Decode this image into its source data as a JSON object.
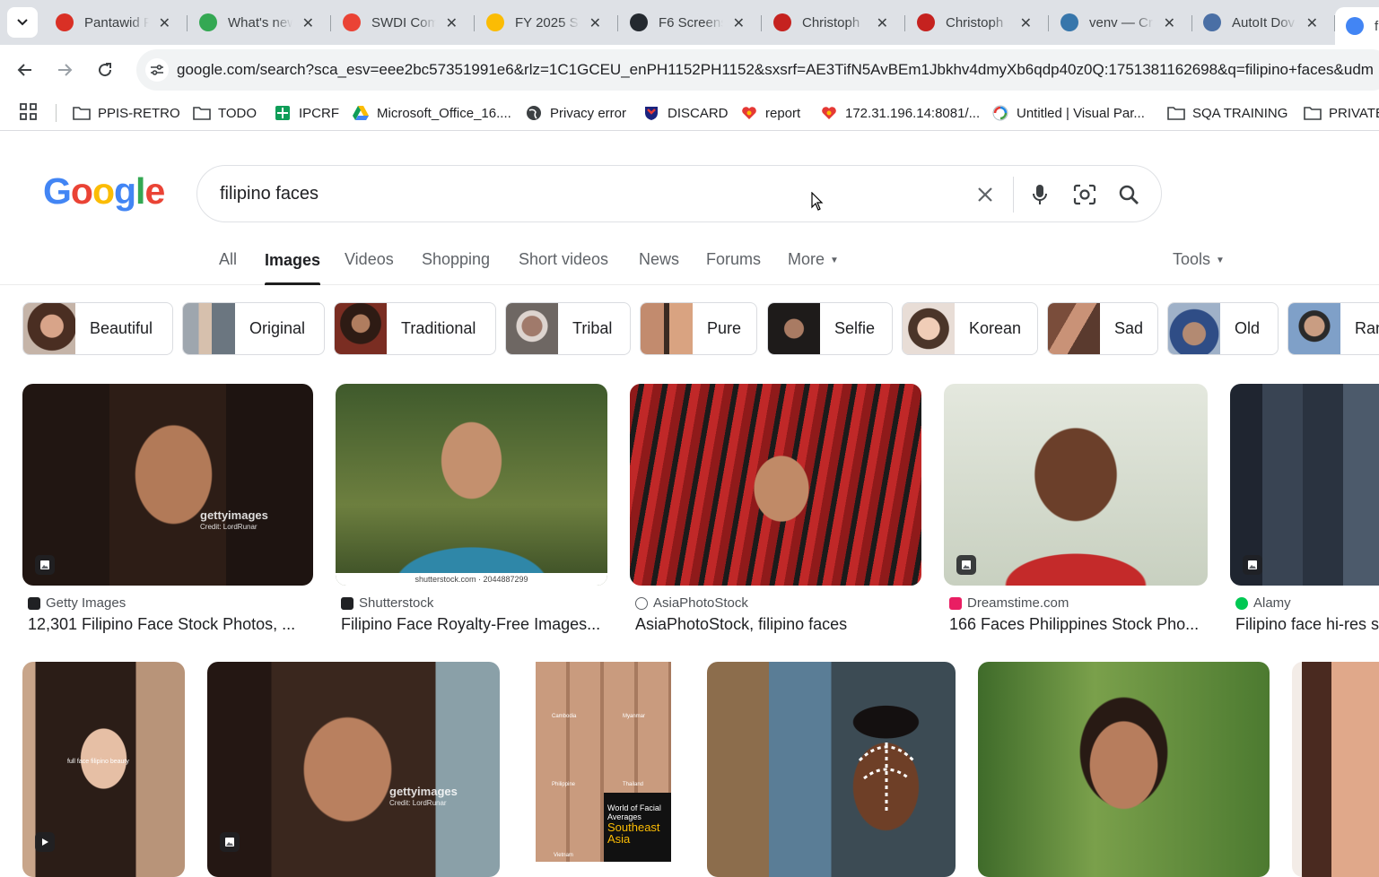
{
  "tabs": [
    {
      "title": "Pantawid P",
      "favicon": "heart-icon",
      "color": "#d93025"
    },
    {
      "title": "What's new",
      "favicon": "chrome-icon",
      "color": "#34a853"
    },
    {
      "title": "SWDI Com",
      "favicon": "gmail-icon",
      "color": "#ea4335"
    },
    {
      "title": "FY 2025 SC",
      "favicon": "drive-icon",
      "color": "#fbbc04"
    },
    {
      "title": "F6 Screens",
      "favicon": "github-icon",
      "color": "#24292f"
    },
    {
      "title": "Christoph",
      "favicon": "record-icon",
      "color": "#c5221f"
    },
    {
      "title": "Christoph",
      "favicon": "record-icon",
      "color": "#c5221f"
    },
    {
      "title": "venv — Cr",
      "favicon": "python-icon",
      "color": "#3776ab"
    },
    {
      "title": "AutoIt Dov",
      "favicon": "autoit-icon",
      "color": "#4a6fa5"
    },
    {
      "title": "fi",
      "favicon": "google-icon",
      "color": "#4285f4"
    }
  ],
  "toolbar": {
    "url": "google.com/search?sca_esv=eee2bc57351991e6&rlz=1C1GCEU_enPH1152PH1152&sxsrf=AE3TifN5AvBEm1Jbkhv4dmyXb6qdp40z0Q:1751381162698&q=filipino+faces&udm"
  },
  "bookmarks": [
    {
      "label": "PPIS-RETRO",
      "icon": "folder-icon"
    },
    {
      "label": "TODO",
      "icon": "folder-icon"
    },
    {
      "label": "IPCRF",
      "icon": "sheets-icon"
    },
    {
      "label": "Microsoft_Office_16....",
      "icon": "drive-icon"
    },
    {
      "label": "Privacy error",
      "icon": "globe-icon"
    },
    {
      "label": "DISCARD",
      "icon": "shield-icon"
    },
    {
      "label": "report",
      "icon": "heart-icon"
    },
    {
      "label": "172.31.196.14:8081/...",
      "icon": "heart-icon"
    },
    {
      "label": "Untitled | Visual Par...",
      "icon": "paradigm-icon"
    },
    {
      "label": "SQA TRAINING",
      "icon": "folder-icon"
    },
    {
      "label": "PRIVATE",
      "icon": "folder-icon"
    }
  ],
  "logo": {
    "letters": [
      "G",
      "o",
      "o",
      "g",
      "l",
      "e"
    ],
    "colors": [
      "#4285f4",
      "#ea4335",
      "#fbbc05",
      "#4285f4",
      "#34a853",
      "#ea4335"
    ]
  },
  "search": {
    "query": "filipino faces"
  },
  "nav": {
    "all": "All",
    "images": "Images",
    "videos": "Videos",
    "shopping": "Shopping",
    "short_videos": "Short videos",
    "news": "News",
    "forums": "Forums",
    "more": "More",
    "tools": "Tools"
  },
  "chips": [
    "Beautiful",
    "Original",
    "Traditional",
    "Tribal",
    "Pure",
    "Selfie",
    "Korean",
    "Sad",
    "Old",
    "Ran"
  ],
  "results_row1": [
    {
      "source": "Getty Images",
      "title": "12,301 Filipino Face Stock Photos, ...",
      "watermark": "gettyimages",
      "credit": "Credit: LordRunar"
    },
    {
      "source": "Shutterstock",
      "title": "Filipino Face Royalty-Free Images...",
      "watermark": "shutterstock.com · 2044887299"
    },
    {
      "source": "AsiaPhotoStock",
      "title": "AsiaPhotoStock, filipino faces"
    },
    {
      "source": "Dreamstime.com",
      "title": "166 Faces Philippines Stock Pho..."
    },
    {
      "source": "Alamy",
      "title": "Filipino face hi-res s"
    }
  ],
  "results_row2": [
    {
      "caption": "full face filipino beauty"
    },
    {
      "watermark": "gettyimages",
      "credit": "Credit: LordRunar"
    },
    {
      "labels": [
        "Cambodia",
        "Myanmar",
        "Philippine",
        "Thailand",
        "Vietnam"
      ],
      "caption": "World of Facial Averages",
      "caption2": "Southeast Asia"
    },
    {},
    {},
    {}
  ]
}
